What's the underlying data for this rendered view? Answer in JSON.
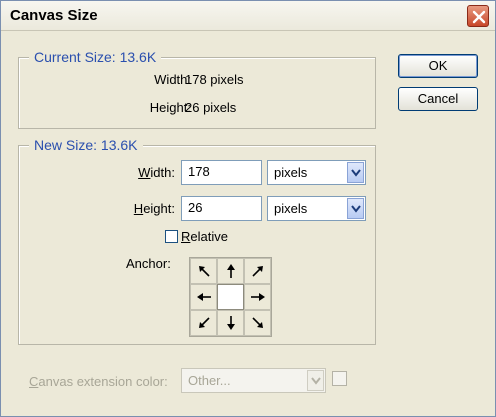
{
  "window": {
    "title": "Canvas Size"
  },
  "buttons": {
    "ok": "OK",
    "cancel": "Cancel"
  },
  "current_size": {
    "legend": "Current Size: 13.6K",
    "width_label": "Width:",
    "width_value": "178 pixels",
    "height_label": "Height:",
    "height_value": "26 pixels"
  },
  "new_size": {
    "legend": "New Size: 13.6K",
    "width_label_u": "W",
    "width_label_rest": "idth:",
    "width_value": "178",
    "width_unit": "pixels",
    "height_label_u": "H",
    "height_label_rest": "eight:",
    "height_value": "26",
    "height_unit": "pixels",
    "relative_u": "R",
    "relative_rest": "elative",
    "relative_checked": false,
    "anchor_label": "Anchor:",
    "anchor_selected": "center"
  },
  "extension": {
    "label_u": "C",
    "label_rest": "anvas extension color:",
    "value": "Other...",
    "enabled": false
  },
  "icons": {
    "close": "close-icon",
    "dropdown": "chevron-down-icon",
    "anchor_arrows": [
      "arrow-up-left-icon",
      "arrow-up-icon",
      "arrow-up-right-icon",
      "arrow-left-icon",
      "anchor-center",
      "arrow-right-icon",
      "arrow-down-left-icon",
      "arrow-down-icon",
      "arrow-down-right-icon"
    ]
  },
  "colors": {
    "accent": "#2a4fae",
    "background": "#ece9d8"
  }
}
